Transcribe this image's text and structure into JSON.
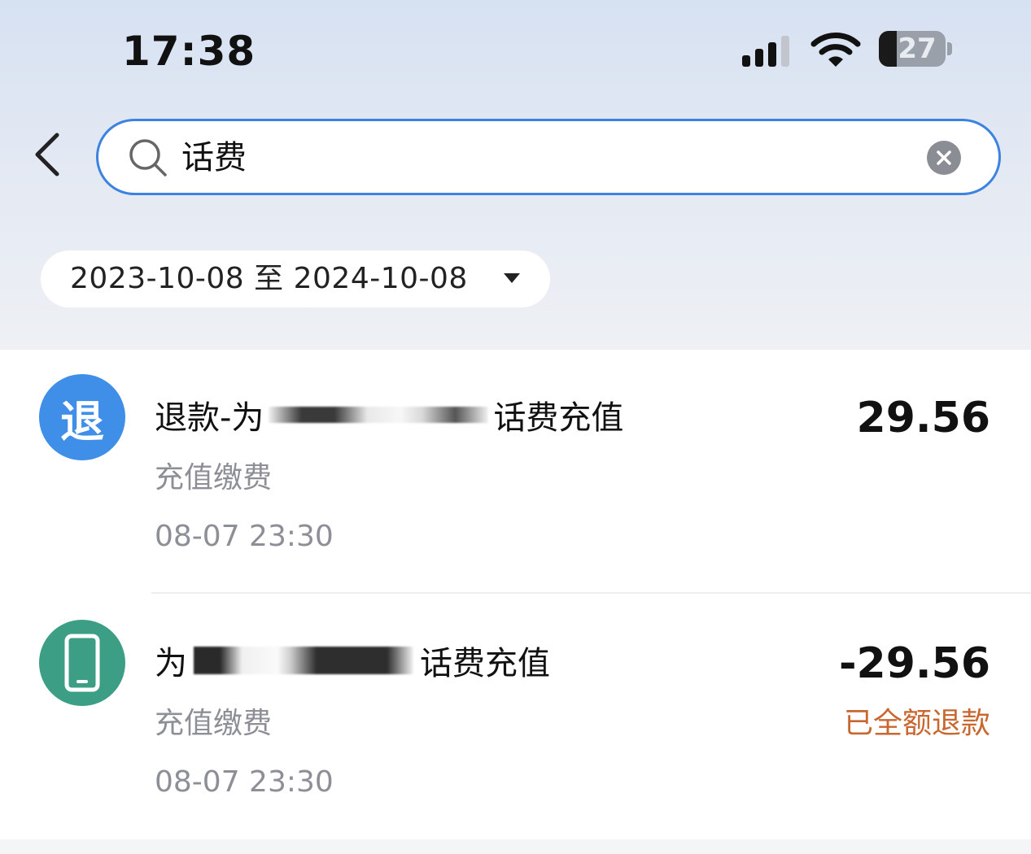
{
  "status_bar": {
    "time": "17:38",
    "battery_level": "27",
    "icons": [
      "signal-icon",
      "wifi-icon",
      "battery-icon"
    ]
  },
  "search": {
    "back_icon": "chevron-left-icon",
    "search_icon": "search-icon",
    "value": "话费",
    "clear_icon": "clear-icon"
  },
  "filter": {
    "date_range": "2023-10-08 至 2024-10-08",
    "dropdown_icon": "caret-down-icon"
  },
  "transactions": [
    {
      "icon": "refund-icon",
      "icon_text": "退",
      "icon_color": "#3f8fe8",
      "title_prefix": "退款-为",
      "title_suffix": "话费充值",
      "category": "充值缴费",
      "time": "08-07 23:30",
      "amount": "29.56",
      "status": ""
    },
    {
      "icon": "phone-icon",
      "icon_color": "#3d9e86",
      "title_prefix": "为",
      "title_suffix": "话费充值",
      "category": "充值缴费",
      "time": "08-07 23:30",
      "amount": "-29.56",
      "status": "已全额退款",
      "status_color": "#c8672f"
    }
  ],
  "colors": {
    "accent": "#3c82e0",
    "header_gradient_top": "#d6e1f2",
    "muted_text": "#8c8f96"
  }
}
